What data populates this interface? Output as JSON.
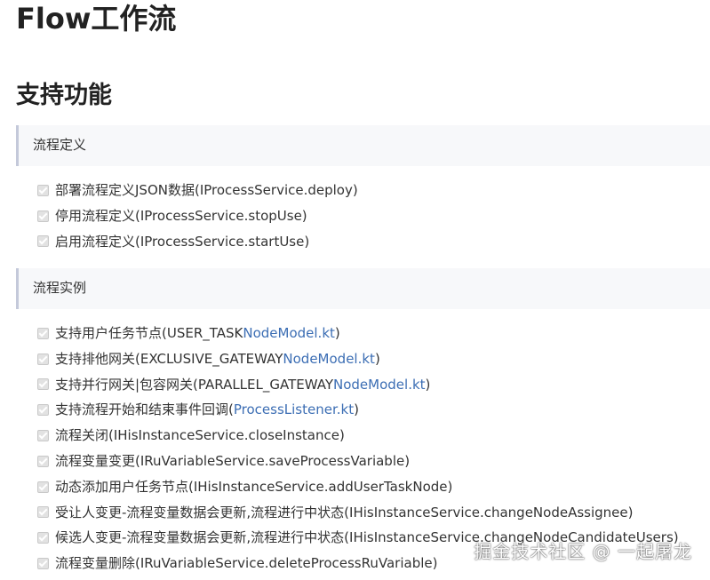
{
  "title": "Flow工作流",
  "subtitle": "支持功能",
  "sections": [
    {
      "heading": "流程定义",
      "items": [
        {
          "text": "部署流程定义JSON数据(IProcessService.deploy)",
          "link": ""
        },
        {
          "text": "停用流程定义(IProcessService.stopUse)",
          "link": ""
        },
        {
          "text": "启用流程定义(IProcessService.startUse)",
          "link": ""
        }
      ]
    },
    {
      "heading": "流程实例",
      "items": [
        {
          "text": "支持用户任务节点(USER_TASK ",
          "link": "NodeModel.kt",
          "suffix": ")"
        },
        {
          "text": "支持排他网关(EXCLUSIVE_GATEWAY ",
          "link": "NodeModel.kt",
          "suffix": ")"
        },
        {
          "text": "支持并行网关|包容网关(PARALLEL_GATEWAY ",
          "link": "NodeModel.kt",
          "suffix": ")"
        },
        {
          "text": "支持流程开始和结束事件回调(",
          "link": "ProcessListener.kt",
          "suffix": ")"
        },
        {
          "text": "流程关闭(IHisInstanceService.closeInstance)",
          "link": ""
        },
        {
          "text": "流程变量变更(IRuVariableService.saveProcessVariable)",
          "link": ""
        },
        {
          "text": "动态添加用户任务节点(IHisInstanceService.addUserTaskNode)",
          "link": ""
        },
        {
          "text": "受让人变更-流程变量数据会更新,流程进行中状态(IHisInstanceService.changeNodeAssignee)",
          "link": ""
        },
        {
          "text": "候选人变更-流程变量数据会更新,流程进行中状态(IHisInstanceService.changeNodeCandidateUsers)",
          "link": ""
        },
        {
          "text": "流程变量删除(IRuVariableService.deleteProcessRuVariable)",
          "link": ""
        }
      ]
    }
  ],
  "watermark": "掘金技术社区 @ 一起屠龙",
  "colors": {
    "link": "#3c6eb4",
    "section_bg": "#f7f8fa",
    "section_border": "#c4c9da",
    "checkbox": "#e2e2e2"
  }
}
